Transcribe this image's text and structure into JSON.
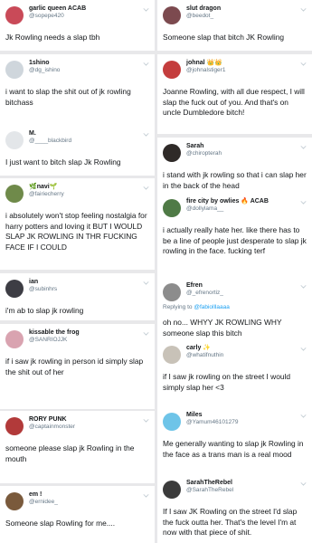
{
  "left": [
    {
      "name": "garlic queen ACAB",
      "handle": "@sopepe420",
      "text": "Jk Rowling needs a slap tbh",
      "avatar_color": "#c94a58"
    },
    {
      "name": "1shino",
      "handle": "@dg_ishino",
      "text": "i want to slap the shit out of jk rowling\nbitchass",
      "avatar_color": "#cfd6dc"
    },
    {
      "name": "M.",
      "handle": "@____blackbird",
      "text": "I just want to bitch slap Jk Rowling",
      "avatar_color": "#e3e6e9"
    },
    {
      "name": "🌿navi🌱",
      "handle": "@fairiecherry",
      "text": "i absolutely won't stop feeling nostalgia for harry potters and loving it BUT I WOULD SLAP JK ROWLING IN THR FUCKING FACE IF I COULD",
      "avatar_color": "#6f8a4a"
    },
    {
      "name": "ian",
      "handle": "@subinhrs",
      "text": "i'm ab to slap jk rowling",
      "avatar_color": "#3d3d44"
    },
    {
      "name": "kissable the frog",
      "handle": "@SANRIOJJK",
      "text": "if i saw jk rowling in person id simply slap the shit out of her",
      "avatar_color": "#d9a3b0"
    },
    {
      "name": "RORY PUNK",
      "handle": "@captainmonster",
      "text": "someone please slap jk Rowling in the mouth",
      "avatar_color": "#b23a3a"
    },
    {
      "name": "em !",
      "handle": "@ernidee_",
      "text": "Someone slap Rowling for me....",
      "avatar_color": "#7a5a3c"
    }
  ],
  "right": [
    {
      "name": "slut dragon",
      "handle": "@beedot_",
      "text": "Someone slap that bitch JK Rowling",
      "avatar_color": "#7c4a4f"
    },
    {
      "name": "johnal 👑👑",
      "handle": "@johnalstiger1",
      "text": "Joanne Rowling, with all due respect, I will slap the fuck out of you. And that's on uncle Dumbledore bitch!",
      "avatar_color": "#c43d3d"
    },
    {
      "name": "Sarah",
      "handle": "@chiropterah",
      "text": "i stand with jk rowling so that i can slap her in the back of the head",
      "avatar_color": "#2f2a28"
    },
    {
      "name": "fire city by owlies 🔥 ACAB",
      "handle": "@dollylama__",
      "text": "i actually really hate her. like there has to be a line of people just desperate to slap jk rowling in the face. fucking terf",
      "avatar_color": "#4f7a46"
    },
    {
      "name": "Efren",
      "handle": "@_efrenortiz_",
      "reply_prefix": "Replying to",
      "reply_to": "@fabiolllaaaa",
      "text": "oh no... WHYY JK ROWLING WHY someone slap this bitch",
      "avatar_color": "#8c8c8c"
    },
    {
      "name": "carly ✨",
      "handle": "@whatifnuthin",
      "text": "if I saw jk rowling on the street I would simply slap her <3",
      "avatar_color": "#c8c2b8"
    },
    {
      "name": "Miles",
      "handle": "@Yamum46101279",
      "text": "Me generally wanting to slap jk Rowling in the face as a trans man is a real mood",
      "avatar_color": "#6ec4e8"
    },
    {
      "name": "SarahTheRebel",
      "handle": "@SarahTheRebel",
      "text": "If I saw JK Rowling on the street I'd slap the fuck outta her. That's the level I'm at now with that piece of shit.",
      "avatar_color": "#3b3b3b"
    }
  ]
}
